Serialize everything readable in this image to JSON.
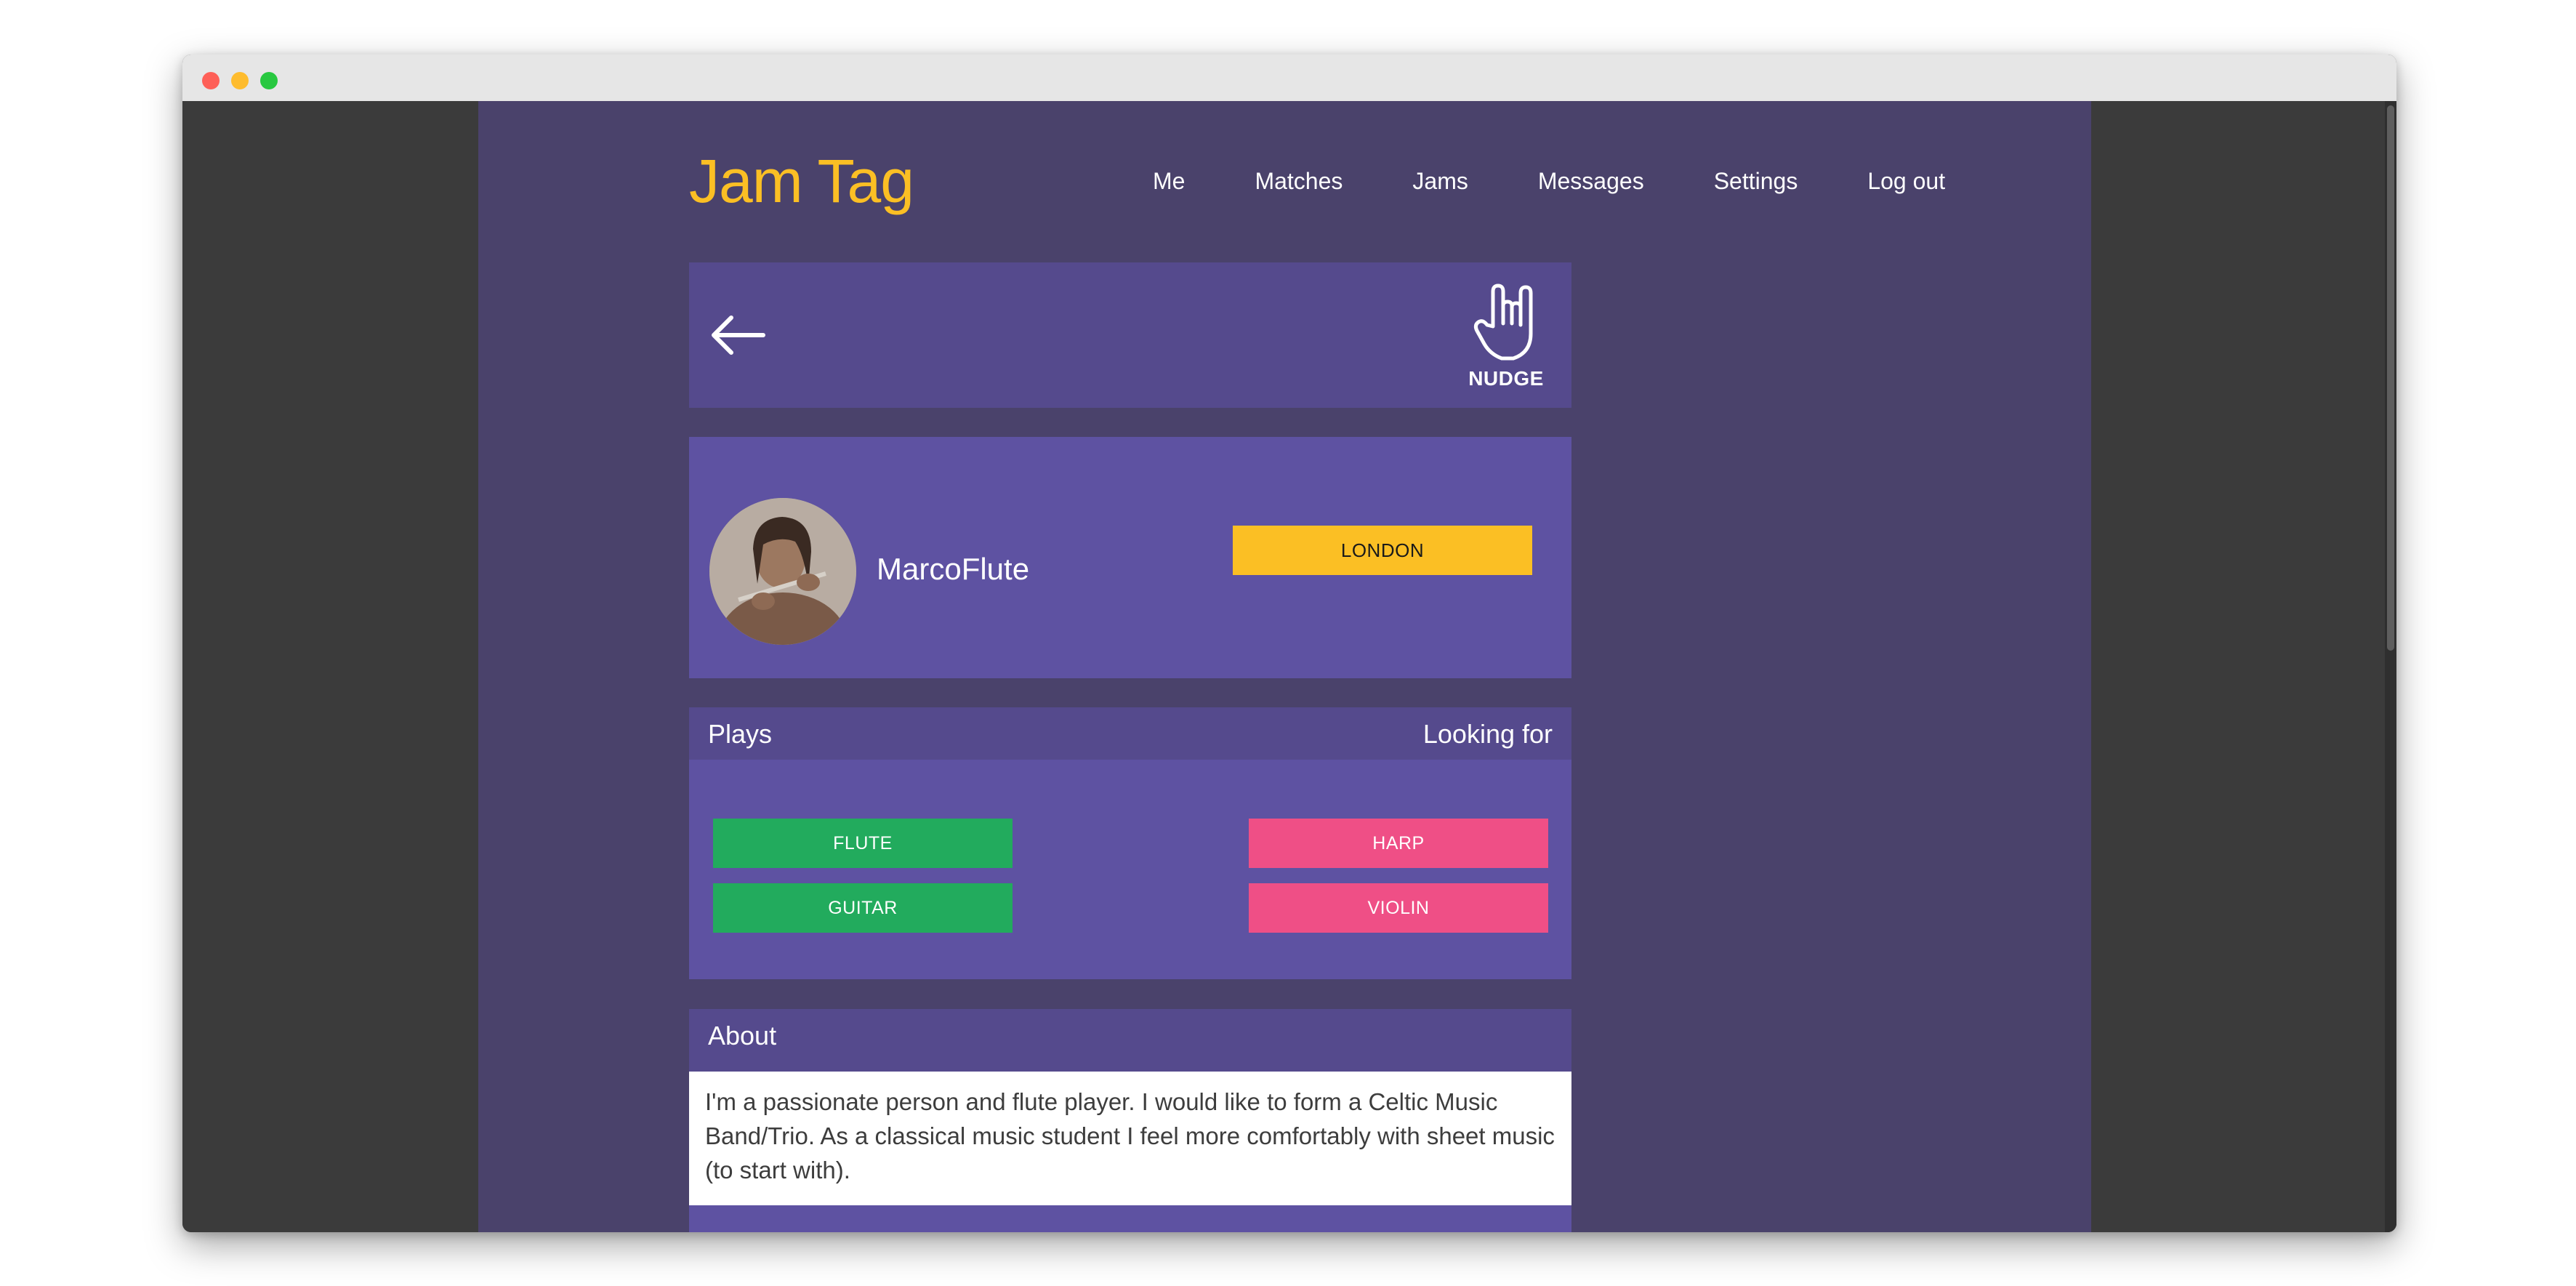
{
  "app": {
    "logo": "Jam Tag"
  },
  "nav": {
    "items": [
      "Me",
      "Matches",
      "Jams",
      "Messages",
      "Settings",
      "Log out"
    ]
  },
  "topbar": {
    "back_icon": "arrow-left-icon",
    "nudge_icon": "rock-hand-icon",
    "nudge_label": "NUDGE"
  },
  "profile": {
    "username": "MarcoFlute",
    "city": "LONDON"
  },
  "instruments": {
    "plays_heading": "Plays",
    "looking_heading": "Looking for",
    "plays": [
      "FLUTE",
      "GUITAR"
    ],
    "looking_for": [
      "HARP",
      "VIOLIN"
    ]
  },
  "about": {
    "heading": "About",
    "text": "I'm a passionate person and flute player. I would like to form a Celtic Music Band/Trio. As a classical music student I feel more comfortably with sheet music (to start with)."
  },
  "colors": {
    "accent": "#fbbf24",
    "page_bg": "#4a426b",
    "card_bg": "#5e52a2",
    "header_bg": "#554a8d",
    "plays_pill": "#22ab5d",
    "looking_pill": "#ef4f86"
  }
}
